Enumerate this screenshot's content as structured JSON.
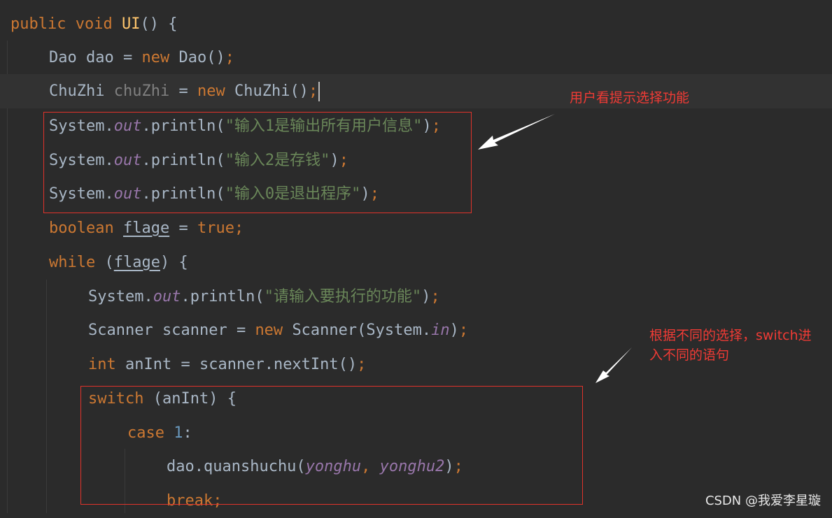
{
  "code": {
    "l1": {
      "kw1": "public",
      "kw2": "void",
      "fn": "UI",
      "rest": "() {"
    },
    "l2": {
      "type": "Dao",
      "var": "dao",
      "eq": "=",
      "kw": "new",
      "ctor": "Dao()",
      "semi": ";"
    },
    "l3": {
      "type": "ChuZhi",
      "var": "chuZhi",
      "eq": "=",
      "kw": "new",
      "ctor": "ChuZhi()",
      "semi": ";"
    },
    "l4": {
      "cls": "System.",
      "fld": "out",
      "call": ".println(",
      "str": "\"输入1是输出所有用户信息\"",
      "close": ")",
      "semi": ";"
    },
    "l5": {
      "cls": "System.",
      "fld": "out",
      "call": ".println(",
      "str": "\"输入2是存钱\"",
      "close": ")",
      "semi": ";"
    },
    "l6": {
      "cls": "System.",
      "fld": "out",
      "call": ".println(",
      "str": "\"输入0是退出程序\"",
      "close": ")",
      "semi": ";"
    },
    "l7": {
      "kw": "boolean",
      "var": "flage",
      "eq": "=",
      "val": "true",
      "semi": ";"
    },
    "l8": {
      "kw": "while",
      "open": "(",
      "var": "flage",
      "close": ") {"
    },
    "l9": {
      "cls": "System.",
      "fld": "out",
      "call": ".println(",
      "str": "\"请输入要执行的功能\"",
      "close": ")",
      "semi": ";"
    },
    "l10": {
      "type": "Scanner",
      "var": "scanner",
      "eq": "=",
      "kw": "new",
      "ctor": "Scanner(System.",
      "fld": "in",
      "close": ")",
      "semi": ";"
    },
    "l11": {
      "kw": "int",
      "var": "anInt",
      "eq": "=",
      "call": "scanner.nextInt()",
      "semi": ";"
    },
    "l12": {
      "kw": "switch",
      "rest": "(anInt) {"
    },
    "l13": {
      "kw": "case",
      "num": "1",
      "colon": ":"
    },
    "l14": {
      "call": "dao.quanshuchu(",
      "a1": "yonghu",
      "comma": ",",
      "a2": "yonghu2",
      "close": ")",
      "semi": ";"
    },
    "l15": {
      "kw": "break",
      "semi": ";"
    }
  },
  "annotations": {
    "note1": "用户看提示选择功能",
    "note2_line1": "根据不同的选择，switch进",
    "note2_line2": "入不同的语句"
  },
  "watermark": "CSDN @我爱李星璇",
  "colors": {
    "background": "#2b2b2b",
    "current_line": "#323232",
    "text": "#a9b7c6",
    "keyword": "#cc7832",
    "string": "#6a8759",
    "field": "#9876aa",
    "number": "#6897bb",
    "function": "#ffc66d",
    "unused": "#808080",
    "annotation": "#f03b35"
  }
}
